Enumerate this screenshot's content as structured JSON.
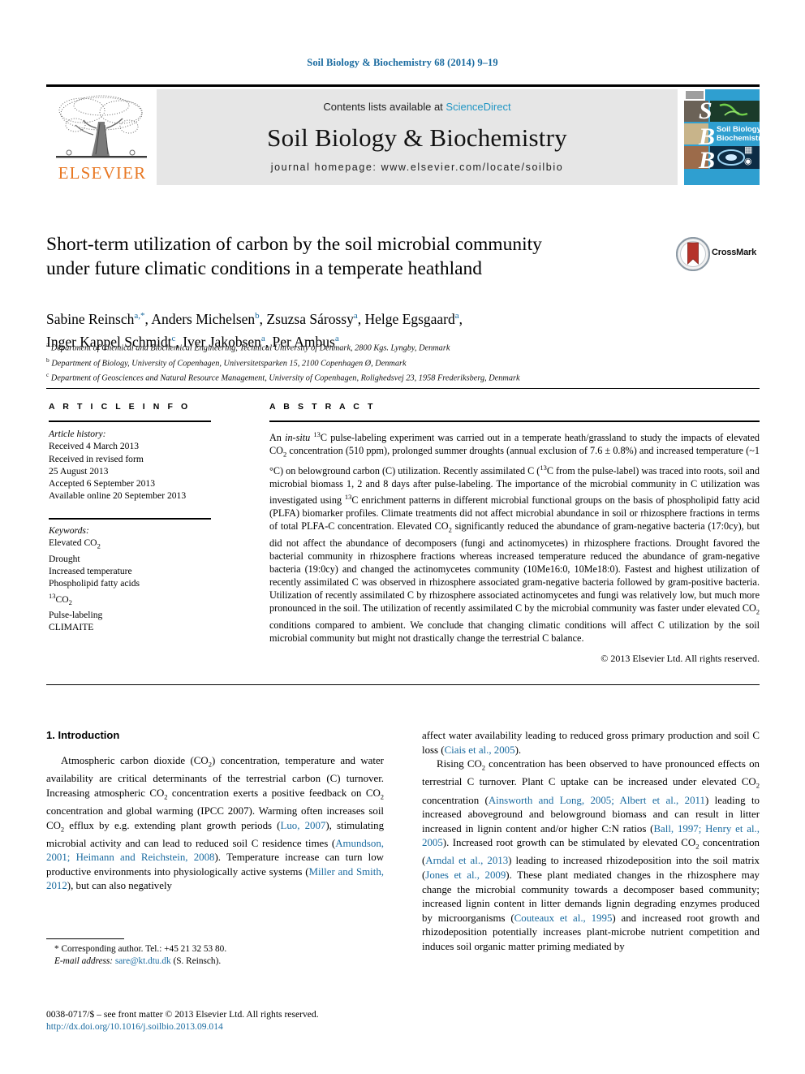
{
  "header": {
    "citation": "Soil Biology & Biochemistry 68 (2014) 9–19",
    "contents_prefix": "Contents lists available at ",
    "sciencedirect": "ScienceDirect",
    "journal_title": "Soil Biology & Biochemistry",
    "homepage": "journal homepage: www.elsevier.com/locate/soilbio",
    "elsevier_label": "ELSEVIER",
    "cover_letters": [
      "S",
      "B",
      "B"
    ],
    "cover_caption_line1": "Soil Biology &",
    "cover_caption_line2": "Biochemistry"
  },
  "crossmark": {
    "label": "CrossMark"
  },
  "article": {
    "title_line1": "Short-term utilization of carbon by the soil microbial community",
    "title_line2": "under future climatic conditions in a temperate heathland",
    "authors": [
      {
        "name": "Sabine Reinsch",
        "marks": "a,*"
      },
      {
        "name": "Anders Michelsen",
        "marks": "b"
      },
      {
        "name": "Zsuzsa Sárossy",
        "marks": "a"
      },
      {
        "name": "Helge Egsgaard",
        "marks": "a"
      },
      {
        "name": "Inger Kappel Schmidt",
        "marks": "c"
      },
      {
        "name": "Iver Jakobsen",
        "marks": "a"
      },
      {
        "name": "Per Ambus",
        "marks": "a"
      }
    ],
    "affiliations": [
      {
        "mark": "a",
        "text": "Department of Chemical and Biochemical Engineering, Technical University of Denmark, 2800 Kgs. Lyngby, Denmark"
      },
      {
        "mark": "b",
        "text": "Department of Biology, University of Copenhagen, Universitetsparken 15, 2100 Copenhagen Ø, Denmark"
      },
      {
        "mark": "c",
        "text": "Department of Geosciences and Natural Resource Management, University of Copenhagen, Rolighedsvej 23, 1958 Frederiksberg, Denmark"
      }
    ]
  },
  "article_info": {
    "heading": "A R T I C L E   I N F O",
    "history_label": "Article history:",
    "history": [
      "Received 4 March 2013",
      "Received in revised form",
      "25 August 2013",
      "Accepted 6 September 2013",
      "Available online 20 September 2013"
    ],
    "keywords_label": "Keywords:",
    "keywords": [
      "Elevated CO2",
      "Drought",
      "Increased temperature",
      "Phospholipid fatty acids",
      "13CO2",
      "Pulse-labeling",
      "CLIMAITE"
    ]
  },
  "abstract": {
    "heading": "A B S T R A C T",
    "text_part1": "An ",
    "insitu": "in-situ",
    "text_part2": " 13C pulse-labeling experiment was carried out in a temperate heath/grassland to study the impacts of elevated CO2 concentration (510 ppm), prolonged summer droughts (annual exclusion of 7.6 ± 0.8%) and increased temperature (~1 °C) on belowground carbon (C) utilization. Recently assimilated C (13C from the pulse-label) was traced into roots, soil and microbial biomass 1, 2 and 8 days after pulse-labeling. The importance of the microbial community in C utilization was investigated using 13C enrichment patterns in different microbial functional groups on the basis of phospholipid fatty acid (PLFA) biomarker profiles. Climate treatments did not affect microbial abundance in soil or rhizosphere fractions in terms of total PLFA-C concentration. Elevated CO2 significantly reduced the abundance of gram-negative bacteria (17:0cy), but did not affect the abundance of decomposers (fungi and actinomycetes) in rhizosphere fractions. Drought favored the bacterial community in rhizosphere fractions whereas increased temperature reduced the abundance of gram-negative bacteria (19:0cy) and changed the actinomycetes community (10Me16:0, 10Me18:0). Fastest and highest utilization of recently assimilated C was observed in rhizosphere associated gram-negative bacteria followed by gram-positive bacteria. Utilization of recently assimilated C by rhizosphere associated actinomycetes and fungi was relatively low, but much more pronounced in the soil. The utilization of recently assimilated C by the microbial community was faster under elevated CO2 conditions compared to ambient. We conclude that changing climatic conditions will affect C utilization by the soil microbial community but might not drastically change the terrestrial C balance.",
    "copyright": "© 2013 Elsevier Ltd. All rights reserved."
  },
  "introduction": {
    "heading": "1. Introduction",
    "left_para1": "Atmospheric carbon dioxide (CO2) concentration, temperature and water availability are critical determinants of the terrestrial carbon (C) turnover. Increasing atmospheric CO2 concentration exerts a positive feedback on CO2 concentration and global warming (IPCC 2007). Warming often increases soil CO2 efflux by e.g. extending plant growth periods (Luo, 2007), stimulating microbial activity and can lead to reduced soil C residence times (Amundson, 2001; Heimann and Reichstein, 2008). Temperature increase can turn low productive environments into physiologically active systems (Miller and Smith, 2012), but can also negatively",
    "right_para1_cont": "affect water availability leading to reduced gross primary production and soil C loss (Ciais et al., 2005).",
    "right_para2": "Rising CO2 concentration has been observed to have pronounced effects on terrestrial C turnover. Plant C uptake can be increased under elevated CO2 concentration (Ainsworth and Long, 2005; Albert et al., 2011) leading to increased aboveground and belowground biomass and can result in litter increased in lignin content and/or higher C:N ratios (Ball, 1997; Henry et al., 2005). Increased root growth can be stimulated by elevated CO2 concentration (Arndal et al., 2013) leading to increased rhizodeposition into the soil matrix (Jones et al., 2009). These plant mediated changes in the rhizosphere may change the microbial community towards a decomposer based community; increased lignin content in litter demands lignin degrading enzymes produced by microorganisms (Couteaux et al., 1995) and increased root growth and rhizodeposition potentially increases plant-microbe nutrient competition and induces soil organic matter priming mediated by",
    "refs_left": [
      "Luo, 2007",
      "Amundson, 2001; Heimann and Reichstein, 2008",
      "Miller and Smith, 2012"
    ],
    "refs_right": [
      "Ciais et al., 2005",
      "Ainsworth and Long, 2005; Albert et al., 2011",
      "Ball, 1997; Henry et al., 2005",
      "Arndal et al., 2013",
      "Jones et al., 2009",
      "Couteaux et al., 1995"
    ]
  },
  "footnote": {
    "corresponding": "* Corresponding author. Tel.: +45 21 32 53 80.",
    "email_label": "E-mail address:",
    "email": "sare@kt.dtu.dk",
    "email_suffix": "(S. Reinsch)."
  },
  "footer": {
    "issn_line": "0038-0717/$ – see front matter © 2013 Elsevier Ltd. All rights reserved.",
    "doi": "http://dx.doi.org/10.1016/j.soilbio.2013.09.014"
  },
  "colors": {
    "link": "#1a6ba0",
    "sciencedirect": "#2196c4",
    "elsevier_orange": "#E87722",
    "cover_blue": "#2f9fd0"
  }
}
